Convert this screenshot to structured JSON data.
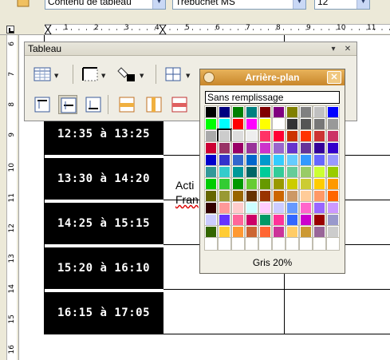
{
  "toolbar_top": {
    "style_value": "Contenu de tableau",
    "font_value": "Trebuchet MS",
    "size_value": "12"
  },
  "ruler": {
    "h_numbers": [
      "1",
      "2",
      "3",
      "4",
      "5",
      "6",
      "7",
      "8",
      "9",
      "10",
      "11"
    ],
    "v_numbers": [
      "6",
      "7",
      "8",
      "9",
      "10",
      "11",
      "12",
      "13",
      "14",
      "15",
      "16"
    ]
  },
  "table": {
    "rows": [
      {
        "time": "12:35 à 13:25"
      },
      {
        "time": "13:30 à 14:20"
      },
      {
        "time": "14:25 à 15:15"
      },
      {
        "time": "15:20 à 16:10"
      },
      {
        "time": "16:15 à 17:05"
      }
    ],
    "activity_line1": "Acti",
    "activity_line2": "Fran"
  },
  "tableau_toolbar": {
    "title": "Tableau",
    "menu_arrow": "▾",
    "close": "✕"
  },
  "background_popup": {
    "title": "Arrière-plan",
    "close": "✕",
    "no_fill": "Sans remplissage",
    "selected_name": "Gris 20%",
    "colors": [
      "#000000",
      "#000080",
      "#008000",
      "#008080",
      "#800000",
      "#800080",
      "#808000",
      "#808080",
      "#c0c0c0",
      "#0000ff",
      "#00ff00",
      "#00ffff",
      "#ff0000",
      "#ff00ff",
      "#ffff00",
      "#ffffff",
      "#333333",
      "#555555",
      "#777777",
      "#999999",
      "#aaaaaa",
      "#cccccc",
      "#dddddd",
      "#eeeeee",
      "#ff3366",
      "#ff0033",
      "#cc3300",
      "#ff3300",
      "#cc3333",
      "#cc3366",
      "#cc0033",
      "#993366",
      "#990066",
      "#993399",
      "#cc33cc",
      "#9966cc",
      "#6633cc",
      "#663399",
      "#330099",
      "#3300cc",
      "#0000cc",
      "#3333cc",
      "#3366cc",
      "#0066cc",
      "#0099cc",
      "#33ccff",
      "#66ccff",
      "#3399ff",
      "#6666ff",
      "#9999ff",
      "#339999",
      "#33cccc",
      "#009999",
      "#006666",
      "#00cc99",
      "#33cc99",
      "#66cc99",
      "#99cc66",
      "#ccff33",
      "#99cc00",
      "#00cc00",
      "#33cc33",
      "#009900",
      "#66cc33",
      "#669900",
      "#999900",
      "#cccc00",
      "#cccc33",
      "#ffcc00",
      "#ff9900",
      "#666600",
      "#999933",
      "#996600",
      "#663300",
      "#993300",
      "#cc6600",
      "#cc9966",
      "#ffcc99",
      "#ff9966",
      "#ff6600",
      "#330000",
      "#ff9999",
      "#ffcccc",
      "#ccffff",
      "#ffccff",
      "#ccccff",
      "#6699ff",
      "#ff66cc",
      "#9966ff",
      "#cc99ff",
      "#ccccff",
      "#6633ff",
      "#ff6699",
      "#cc0066",
      "#009966",
      "#ff3399",
      "#3366ff",
      "#cc00cc",
      "#990000",
      "#9999cc",
      "#336600",
      "#ffcc33",
      "#ff9933",
      "#cc6633",
      "#ff6633",
      "#cc3399",
      "#ffcc66",
      "#cc9933",
      "#996699",
      "#cccccc",
      "#ffffff",
      "#ffffff",
      "#ffffff",
      "#ffffff",
      "#ffffff",
      "#ffffff",
      "#ffffff",
      "#ffffff",
      "#ffffff",
      "#ffffff"
    ]
  }
}
